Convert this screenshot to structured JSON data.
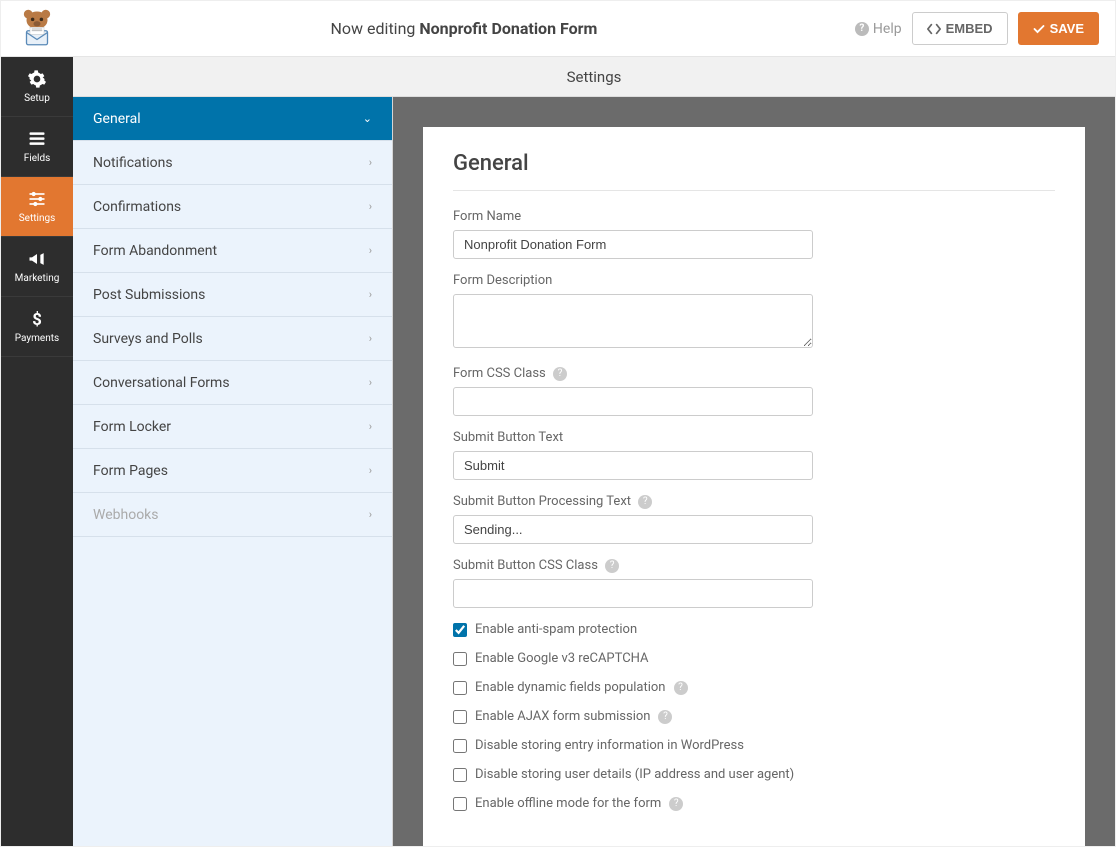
{
  "topbar": {
    "title_prefix": "Now editing",
    "title_name": "Nonprofit Donation Form",
    "help_label": "Help",
    "embed_label": "EMBED",
    "save_label": "SAVE"
  },
  "nav": [
    {
      "label": "Setup",
      "icon": "gear-icon"
    },
    {
      "label": "Fields",
      "icon": "list-icon"
    },
    {
      "label": "Settings",
      "icon": "sliders-icon"
    },
    {
      "label": "Marketing",
      "icon": "megaphone-icon"
    },
    {
      "label": "Payments",
      "icon": "dollar-icon"
    }
  ],
  "section_header": "Settings",
  "sidebar": [
    {
      "label": "General",
      "active": true,
      "chevron": "down"
    },
    {
      "label": "Notifications"
    },
    {
      "label": "Confirmations"
    },
    {
      "label": "Form Abandonment"
    },
    {
      "label": "Post Submissions"
    },
    {
      "label": "Surveys and Polls"
    },
    {
      "label": "Conversational Forms"
    },
    {
      "label": "Form Locker"
    },
    {
      "label": "Form Pages"
    },
    {
      "label": "Webhooks",
      "disabled": true
    }
  ],
  "panel": {
    "heading": "General",
    "fields": {
      "form_name_label": "Form Name",
      "form_name_value": "Nonprofit Donation Form",
      "form_desc_label": "Form Description",
      "form_desc_value": "",
      "form_css_label": "Form CSS Class",
      "form_css_value": "",
      "submit_text_label": "Submit Button Text",
      "submit_text_value": "Submit",
      "submit_processing_label": "Submit Button Processing Text",
      "submit_processing_value": "Sending...",
      "submit_css_label": "Submit Button CSS Class",
      "submit_css_value": ""
    },
    "checkboxes": [
      {
        "label": "Enable anti-spam protection",
        "checked": true
      },
      {
        "label": "Enable Google v3 reCAPTCHA",
        "checked": false
      },
      {
        "label": "Enable dynamic fields population",
        "checked": false,
        "help": true
      },
      {
        "label": "Enable AJAX form submission",
        "checked": false,
        "help": true
      },
      {
        "label": "Disable storing entry information in WordPress",
        "checked": false
      },
      {
        "label": "Disable storing user details (IP address and user agent)",
        "checked": false
      },
      {
        "label": "Enable offline mode for the form",
        "checked": false,
        "help": true
      }
    ]
  }
}
